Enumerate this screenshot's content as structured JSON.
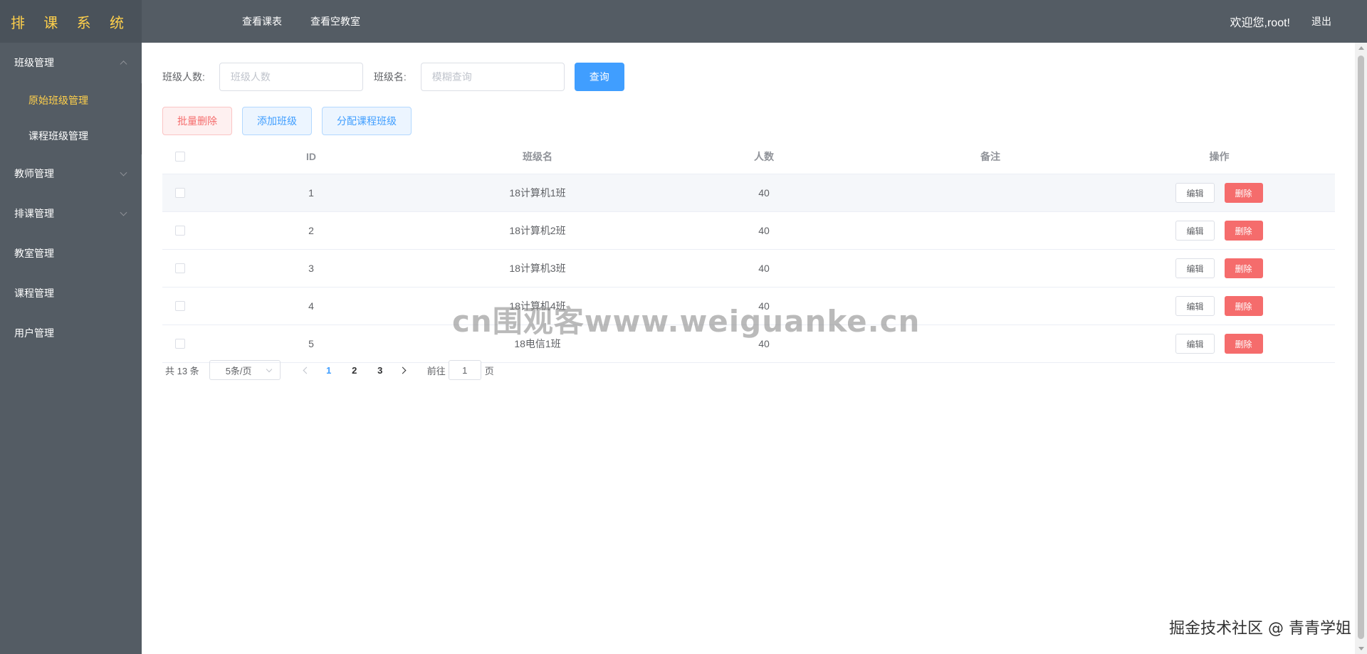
{
  "app": {
    "logo": "排 课 系 统"
  },
  "topnav": {
    "items": [
      "查看课表",
      "查看空教室"
    ]
  },
  "user": {
    "welcome": "欢迎您,root!",
    "logout": "退出"
  },
  "sidebar": {
    "groups": [
      {
        "label": "班级管理",
        "expanded": true,
        "children": [
          {
            "label": "原始班级管理",
            "active": true
          },
          {
            "label": "课程班级管理",
            "active": false
          }
        ]
      },
      {
        "label": "教师管理",
        "expanded": false
      },
      {
        "label": "排课管理",
        "expanded": false
      },
      {
        "label": "教室管理"
      },
      {
        "label": "课程管理"
      },
      {
        "label": "用户管理"
      }
    ]
  },
  "search": {
    "count_label": "班级人数:",
    "count_placeholder": "班级人数",
    "name_label": "班级名:",
    "name_placeholder": "模糊查询",
    "query_button": "查询"
  },
  "actions": {
    "batch_delete": "批量删除",
    "add_class": "添加班级",
    "assign_course_class": "分配课程班级"
  },
  "table": {
    "headers": {
      "id": "ID",
      "name": "班级名",
      "count": "人数",
      "note": "备注",
      "op": "操作"
    },
    "edit_label": "编辑",
    "delete_label": "删除",
    "rows": [
      {
        "id": "1",
        "name": "18计算机1班",
        "count": "40",
        "note": ""
      },
      {
        "id": "2",
        "name": "18计算机2班",
        "count": "40",
        "note": ""
      },
      {
        "id": "3",
        "name": "18计算机3班",
        "count": "40",
        "note": ""
      },
      {
        "id": "4",
        "name": "18计算机4班",
        "count": "40",
        "note": ""
      },
      {
        "id": "5",
        "name": "18电信1班",
        "count": "40",
        "note": ""
      }
    ]
  },
  "pagination": {
    "total": "共 13 条",
    "page_size": "5条/页",
    "pages": [
      "1",
      "2",
      "3"
    ],
    "current": "1",
    "goto_prefix": "前往",
    "goto_value": "1",
    "goto_suffix": "页"
  },
  "watermarks": {
    "center": "cn围观客www.weiguanke.cn",
    "corner": "掘金技术社区 @ 青青学姐"
  },
  "colors": {
    "header_bg": "#545c64",
    "accent_gold": "#ffd04b",
    "primary": "#409eff",
    "danger": "#f56c6c"
  }
}
